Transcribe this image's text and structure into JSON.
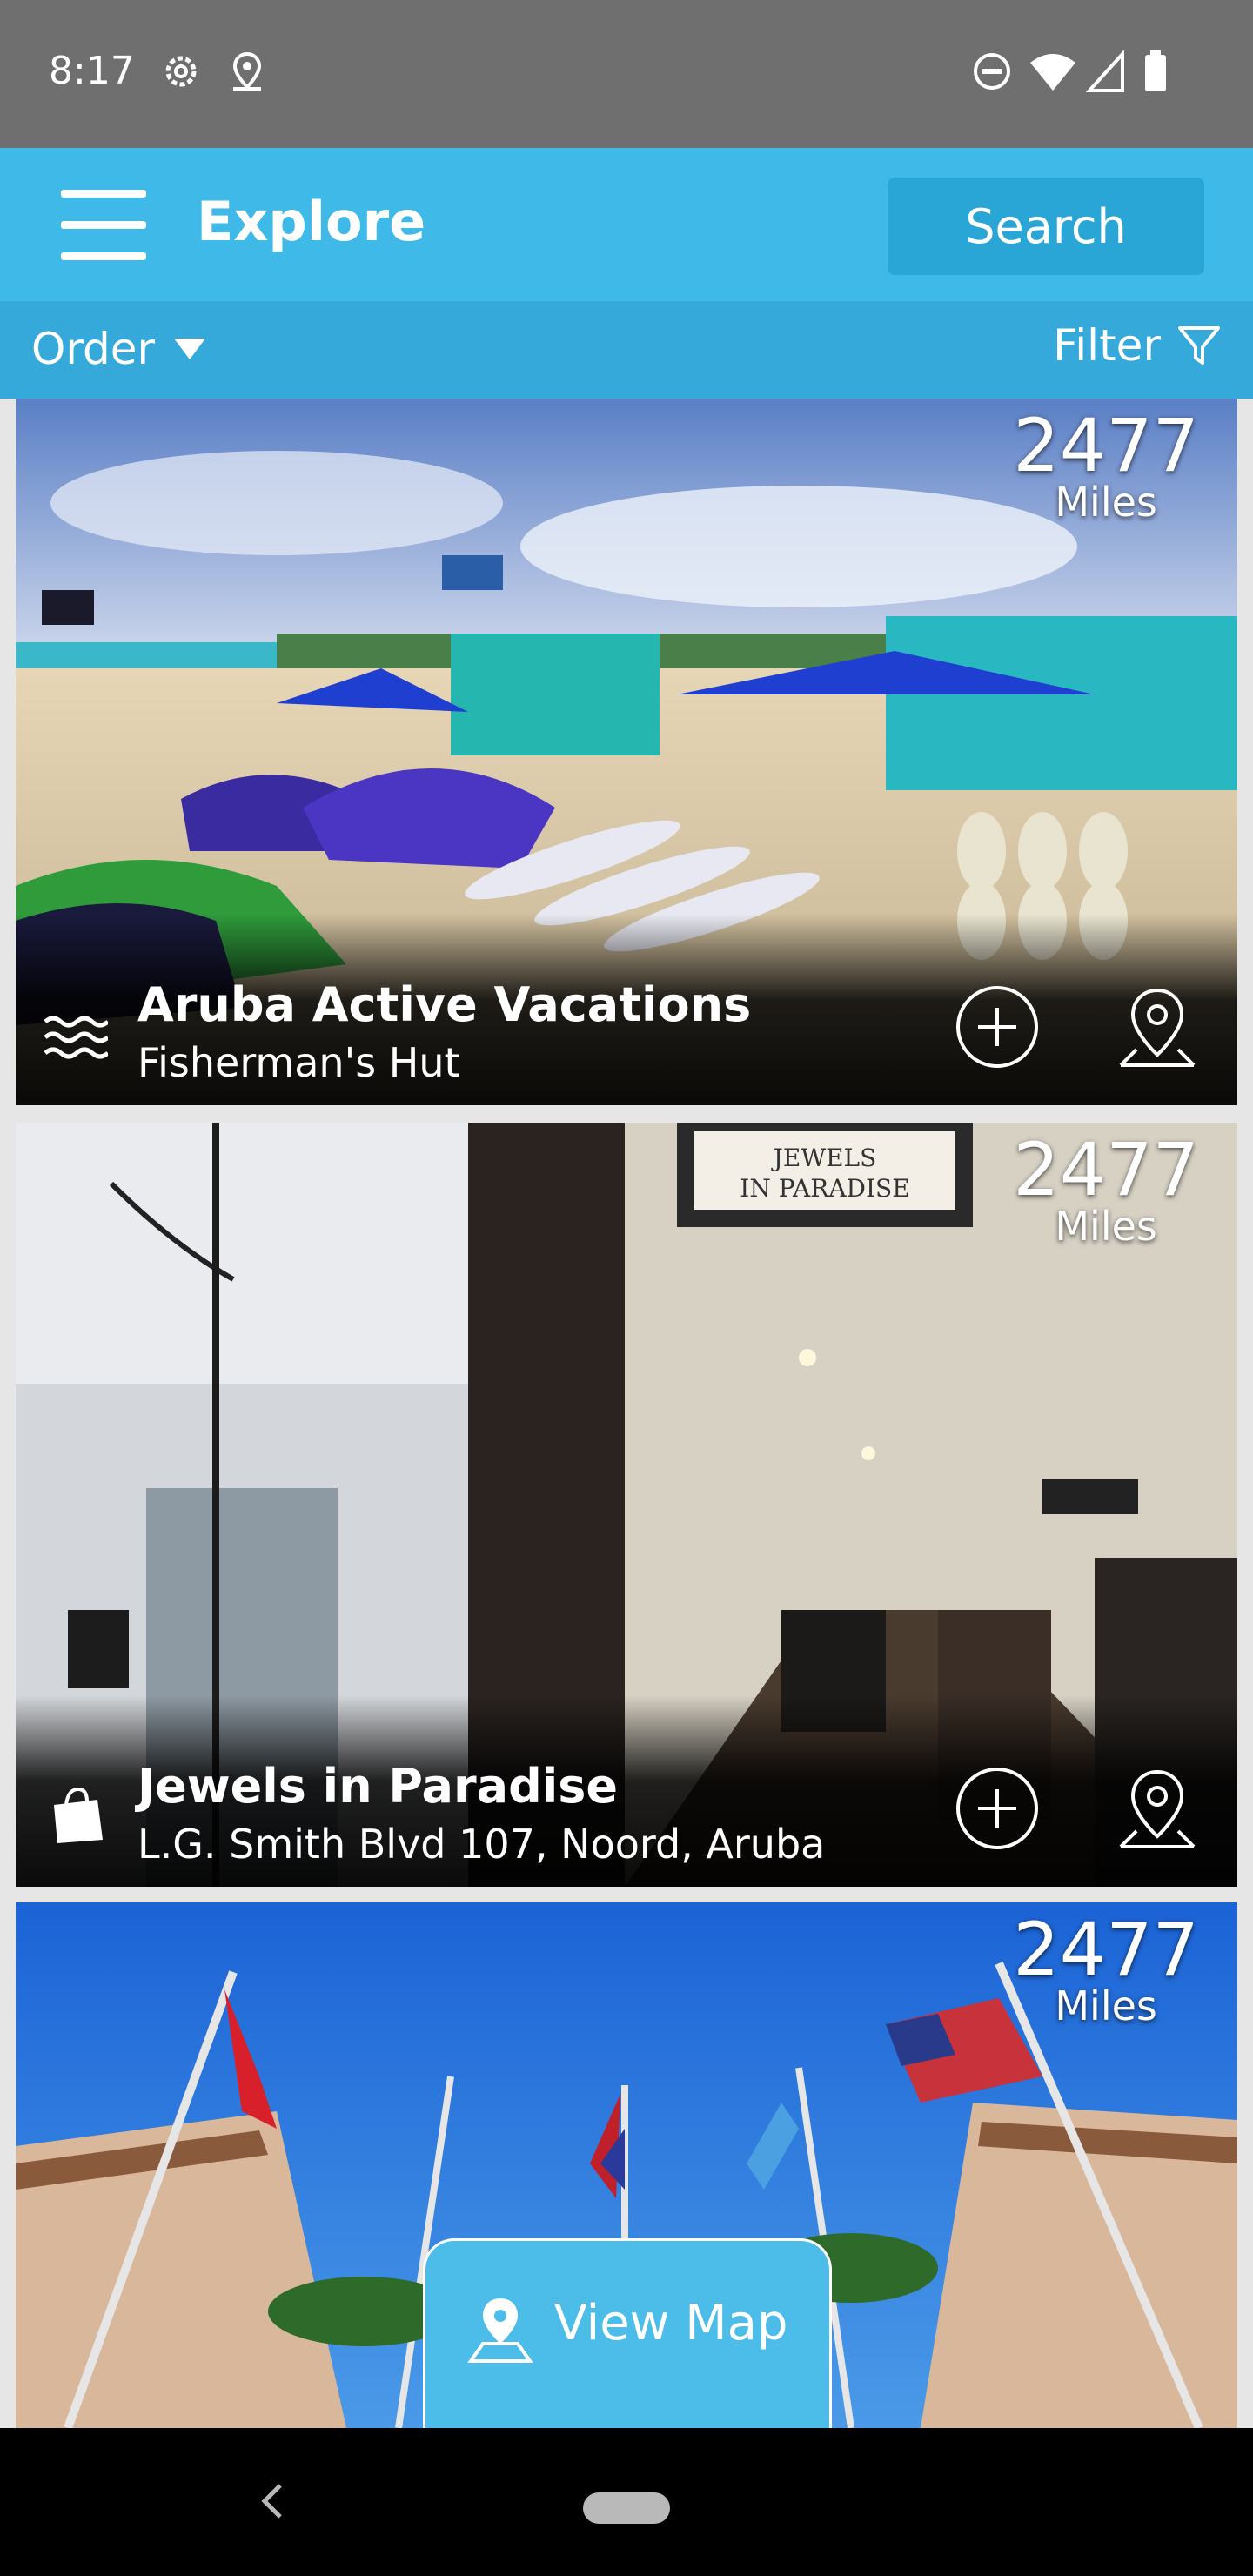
{
  "status_bar": {
    "time": "8:17",
    "icons": [
      "settings-icon",
      "location-pin-icon",
      "do-not-disturb-icon",
      "wifi-icon",
      "signal-icon",
      "battery-icon"
    ]
  },
  "app_bar": {
    "title": "Explore",
    "search_label": "Search",
    "menu_icon": "hamburger-menu-icon"
  },
  "sub_bar": {
    "order_label": "Order",
    "filter_label": "Filter"
  },
  "colors": {
    "app_bar": "#3fb9e8",
    "sub_bar": "#35a9d9",
    "search_button": "#2aa6d6",
    "view_map_button": "#4cbde9"
  },
  "cards": [
    {
      "distance": "2477",
      "distance_unit": "Miles",
      "title": "Aruba Active Vacations",
      "subtitle": "Fisherman's Hut",
      "category_icon": "waves-icon"
    },
    {
      "distance": "2477",
      "distance_unit": "Miles",
      "title": "Jewels in Paradise",
      "subtitle": "L.G. Smith Blvd 107, Noord, Aruba",
      "category_icon": "shopping-bag-icon"
    },
    {
      "distance": "2477",
      "distance_unit": "Miles",
      "title": "",
      "subtitle": "",
      "category_icon": ""
    }
  ],
  "view_map": {
    "label": "View Map"
  }
}
